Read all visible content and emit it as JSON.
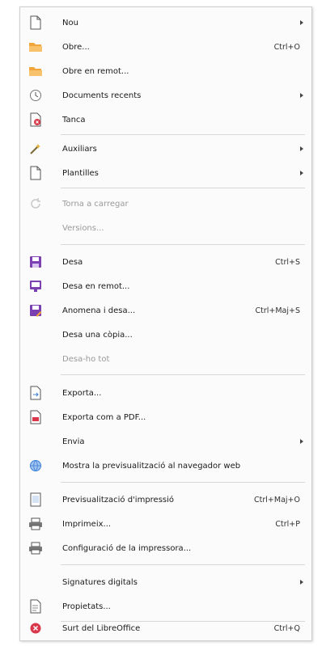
{
  "menu": {
    "items": [
      {
        "label": "Nou",
        "shortcut": "",
        "icon": "new-document-icon"
      },
      {
        "label": "Obre...",
        "shortcut": "Ctrl+O",
        "icon": "open-folder-icon"
      },
      {
        "label": "Obre en remot...",
        "shortcut": "",
        "icon": "open-remote-folder-icon"
      },
      {
        "label": "Documents recents",
        "shortcut": "",
        "icon": "recent-documents-clock-icon"
      },
      {
        "label": "Tanca",
        "shortcut": "",
        "icon": "close-document-icon"
      },
      {
        "label": "Auxiliars",
        "shortcut": "",
        "icon": "wizards-icon"
      },
      {
        "label": "Plantilles",
        "shortcut": "",
        "icon": "templates-icon"
      },
      {
        "label": "Torna a carregar",
        "shortcut": "",
        "icon": "reload-icon"
      },
      {
        "label": "Versions...",
        "shortcut": "",
        "icon": ""
      },
      {
        "label": "Desa",
        "shortcut": "Ctrl+S",
        "icon": "save-icon"
      },
      {
        "label": "Desa en remot...",
        "shortcut": "",
        "icon": "save-remote-icon"
      },
      {
        "label": "Anomena i desa...",
        "shortcut": "Ctrl+Maj+S",
        "icon": "save-as-icon"
      },
      {
        "label": "Desa una còpia...",
        "shortcut": "",
        "icon": ""
      },
      {
        "label": "Desa-ho tot",
        "shortcut": "",
        "icon": ""
      },
      {
        "label": "Exporta...",
        "shortcut": "",
        "icon": "export-icon"
      },
      {
        "label": "Exporta com a PDF...",
        "shortcut": "",
        "icon": "export-pdf-icon"
      },
      {
        "label": "Envia",
        "shortcut": "",
        "icon": ""
      },
      {
        "label": "Mostra la previsualització al navegador web",
        "shortcut": "",
        "icon": "web-browser-globe-icon"
      },
      {
        "label": "Previsualització d'impressió",
        "shortcut": "Ctrl+Maj+O",
        "icon": "print-preview-icon"
      },
      {
        "label": "Imprimeix...",
        "shortcut": "Ctrl+P",
        "icon": "print-icon"
      },
      {
        "label": "Configuració de la impressora...",
        "shortcut": "",
        "icon": "printer-settings-icon"
      },
      {
        "label": "Signatures digitals",
        "shortcut": "",
        "icon": ""
      },
      {
        "label": "Propietats...",
        "shortcut": "",
        "icon": "properties-icon"
      },
      {
        "label": "Surt del LibreOffice",
        "shortcut": "Ctrl+Q",
        "icon": "exit-icon"
      }
    ]
  },
  "colors": {
    "accent_purple": "#7a3fb0",
    "folder_orange": "#f2a53a",
    "exit_red": "#d9384b",
    "globe_blue": "#3b7fd6"
  }
}
